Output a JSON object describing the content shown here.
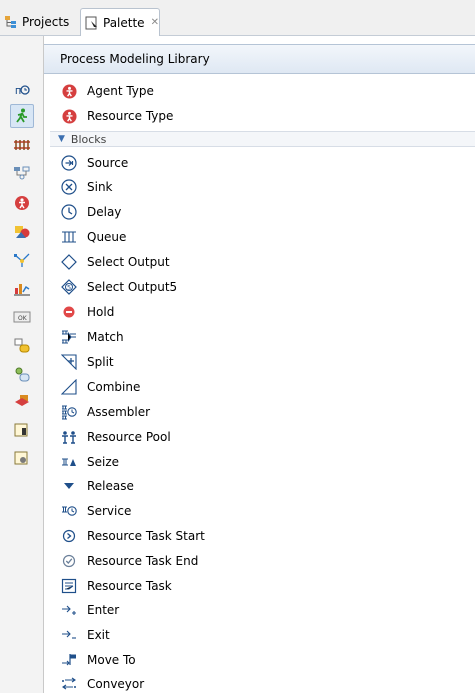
{
  "tabs": [
    {
      "label": "Projects",
      "icon": "projects-icon"
    },
    {
      "label": "Palette",
      "icon": "palette-icon",
      "close": "✕"
    }
  ],
  "header": {
    "title": "Process Modeling Library"
  },
  "left_tools": [
    "process-modeling-library-icon",
    "pedestrian-icon",
    "rail-icon",
    "fluid-icon",
    "agent-icon",
    "presentation-icon",
    "space-markup-icon",
    "analysis-icon",
    "controls-icon",
    "connectivity-icon",
    "agent-picture-icon",
    "pictures-icon",
    "system-dynamics-icon",
    "actionchart-icon"
  ],
  "agent_items": [
    {
      "label": "Agent Type",
      "icon": "agent-type-icon"
    },
    {
      "label": "Resource Type",
      "icon": "resource-type-icon"
    }
  ],
  "section": {
    "label": "Blocks"
  },
  "blocks": [
    {
      "label": "Source",
      "icon": "source-icon"
    },
    {
      "label": "Sink",
      "icon": "sink-icon"
    },
    {
      "label": "Delay",
      "icon": "delay-icon"
    },
    {
      "label": "Queue",
      "icon": "queue-icon"
    },
    {
      "label": "Select Output",
      "icon": "select-output-icon"
    },
    {
      "label": "Select Output5",
      "icon": "select-output5-icon"
    },
    {
      "label": "Hold",
      "icon": "hold-icon"
    },
    {
      "label": "Match",
      "icon": "match-icon"
    },
    {
      "label": "Split",
      "icon": "split-icon"
    },
    {
      "label": "Combine",
      "icon": "combine-icon"
    },
    {
      "label": "Assembler",
      "icon": "assembler-icon"
    },
    {
      "label": "Resource Pool",
      "icon": "resource-pool-icon"
    },
    {
      "label": "Seize",
      "icon": "seize-icon"
    },
    {
      "label": "Release",
      "icon": "release-icon"
    },
    {
      "label": "Service",
      "icon": "service-icon"
    },
    {
      "label": "Resource Task Start",
      "icon": "resource-task-start-icon"
    },
    {
      "label": "Resource Task End",
      "icon": "resource-task-end-icon"
    },
    {
      "label": "Resource Task",
      "icon": "resource-task-icon"
    },
    {
      "label": "Enter",
      "icon": "enter-icon"
    },
    {
      "label": "Exit",
      "icon": "exit-icon"
    },
    {
      "label": "Move To",
      "icon": "move-to-icon"
    },
    {
      "label": "Conveyor",
      "icon": "conveyor-icon"
    }
  ],
  "colors": {
    "accent_blue": "#3c6fb0",
    "agent_red": "#d53f3f",
    "hold_red": "#e14848",
    "green": "#2a9a2a",
    "orange": "#d98a1f"
  }
}
